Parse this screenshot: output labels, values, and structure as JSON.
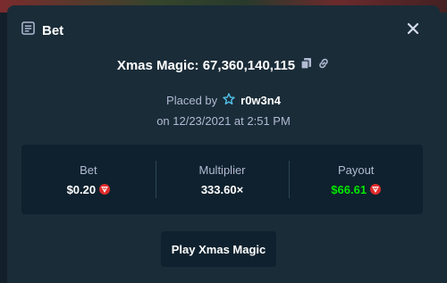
{
  "modal": {
    "title": "Bet",
    "game_title": "Xmas Magic: 67,360,140,115",
    "placed_by_prefix": "Placed by",
    "username": "r0w3n4",
    "date_line": "on 12/23/2021 at 2:51 PM",
    "play_button": "Play Xmas Magic"
  },
  "stats": {
    "bet": {
      "label": "Bet",
      "value": "$0.20"
    },
    "multiplier": {
      "label": "Multiplier",
      "value": "333.60×"
    },
    "payout": {
      "label": "Payout",
      "value": "$66.61"
    }
  },
  "colors": {
    "background": "#1a2c38",
    "panel": "#0f212e",
    "muted_text": "#b1bad3",
    "win_green": "#00e701",
    "coin_red": "#e02a2a",
    "user_icon": "#52c1e8"
  },
  "icons": [
    "bet-slip-icon",
    "close-icon",
    "copy-icon",
    "link-icon",
    "star-user-icon",
    "coin-icon"
  ]
}
